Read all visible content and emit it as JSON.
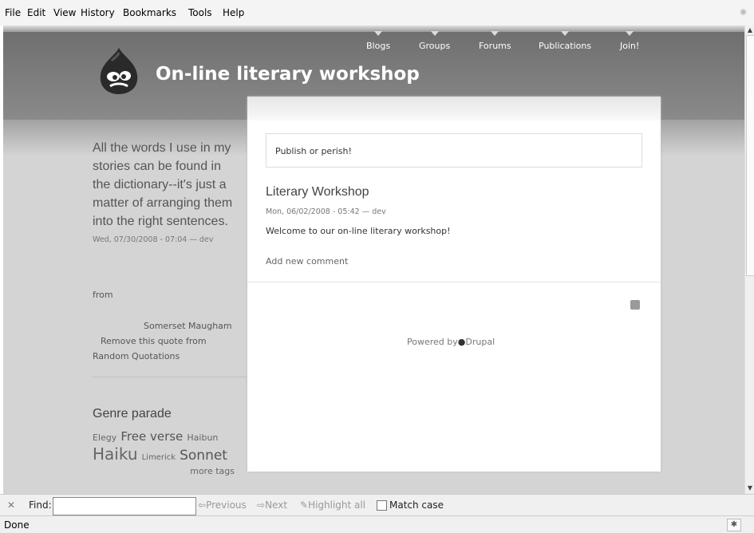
{
  "menu": {
    "items": [
      {
        "label": "File"
      },
      {
        "label": "Edit"
      },
      {
        "label": "View"
      },
      {
        "label": "History"
      },
      {
        "label": "Bookmarks"
      },
      {
        "label": "Tools"
      },
      {
        "label": "Help"
      }
    ]
  },
  "site": {
    "title": "On-line literary workshop",
    "nav": [
      {
        "label": "Blogs"
      },
      {
        "label": "Groups"
      },
      {
        "label": "Forums"
      },
      {
        "label": "Publications"
      },
      {
        "label": "Join!"
      }
    ]
  },
  "sidebar": {
    "quote": "All the words I use in my stories can be found in the dictionary--it's just a matter of arranging them into the right sentences.",
    "quote_meta": "Wed, 07/30/2008 - 07:04 — dev",
    "from_label": "from",
    "author": "Somerset Maugham",
    "remove_link": "Remove this quote from",
    "remove_link2": "Random Quotations",
    "genre_title": "Genre parade",
    "tags": [
      {
        "label": "Elegy"
      },
      {
        "label": "Free verse"
      },
      {
        "label": "Haibun"
      },
      {
        "label": "Haiku"
      },
      {
        "label": "Limerick"
      },
      {
        "label": "Sonnet"
      }
    ],
    "more_tags": "more tags"
  },
  "main": {
    "mission": "Publish or perish!",
    "node_title": "Literary Workshop",
    "node_meta": "Mon, 06/02/2008 - 05:42 — dev",
    "node_body": "Welcome to our on-line literary workshop!",
    "add_comment": "Add new comment",
    "powered_prefix": "Powered by",
    "powered_brand": "Drupal"
  },
  "findbar": {
    "label": "Find:",
    "input_value": "",
    "previous": "Previous",
    "next": "Next",
    "highlight": "Highlight all",
    "match_case": "Match case",
    "match_case_checked": false
  },
  "status": {
    "text": "Done"
  },
  "colors": {
    "header_gray": "#7a7a7a",
    "body_gray": "#d4d4d4"
  }
}
